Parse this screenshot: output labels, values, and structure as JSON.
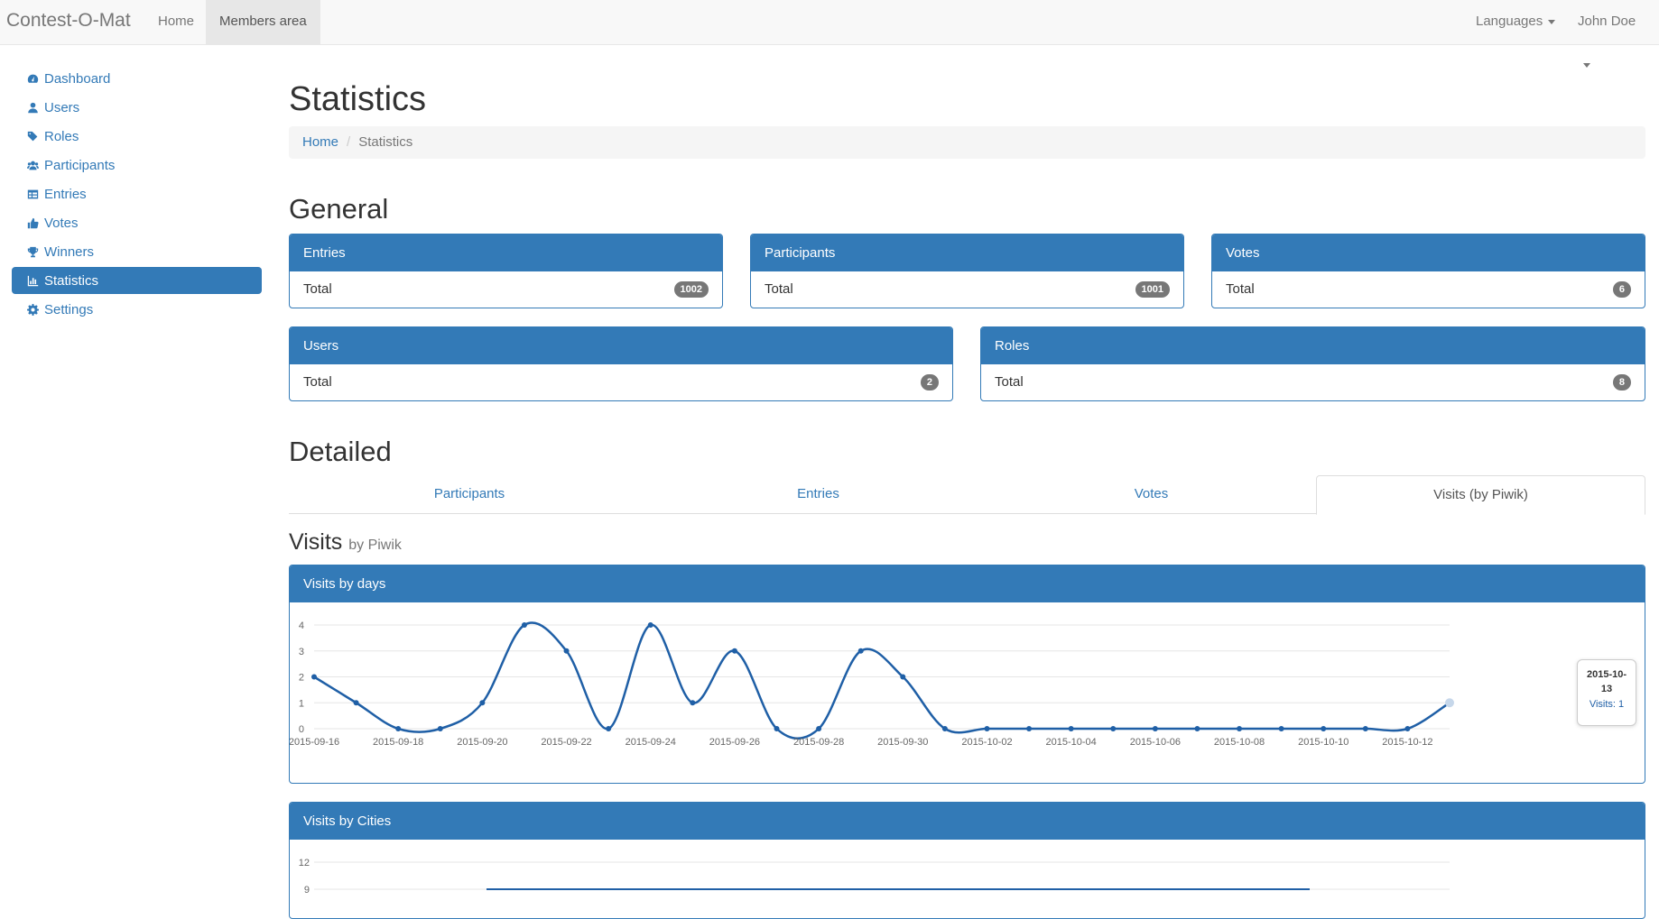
{
  "navbar": {
    "brand": "Contest-O-Mat",
    "home": "Home",
    "members": "Members area",
    "languages": "Languages",
    "user": "John Doe"
  },
  "sidebar": {
    "items": [
      {
        "label": "Dashboard",
        "icon": "dashboard-icon"
      },
      {
        "label": "Users",
        "icon": "user-icon"
      },
      {
        "label": "Roles",
        "icon": "tags-icon"
      },
      {
        "label": "Participants",
        "icon": "users-icon"
      },
      {
        "label": "Entries",
        "icon": "table-icon"
      },
      {
        "label": "Votes",
        "icon": "thumbs-up-icon"
      },
      {
        "label": "Winners",
        "icon": "trophy-icon"
      },
      {
        "label": "Statistics",
        "icon": "bar-chart-icon",
        "active": true
      },
      {
        "label": "Settings",
        "icon": "gear-icon"
      }
    ]
  },
  "page": {
    "title": "Statistics",
    "breadcrumb": {
      "home": "Home",
      "current": "Statistics"
    },
    "general_title": "General",
    "detailed_title": "Detailed"
  },
  "general": {
    "entries": {
      "title": "Entries",
      "row_label": "Total",
      "count": "1002"
    },
    "participants": {
      "title": "Participants",
      "row_label": "Total",
      "count": "1001"
    },
    "votes": {
      "title": "Votes",
      "row_label": "Total",
      "count": "6"
    },
    "users": {
      "title": "Users",
      "row_label": "Total",
      "count": "2"
    },
    "roles": {
      "title": "Roles",
      "row_label": "Total",
      "count": "8"
    }
  },
  "tabs": {
    "participants": "Participants",
    "entries": "Entries",
    "votes": "Votes",
    "visits": "Visits (by Piwik)",
    "active": "visits"
  },
  "visits": {
    "title": "Visits",
    "subtitle": "by Piwik",
    "days_panel_title": "Visits by days",
    "cities_panel_title": "Visits by Cities",
    "tooltip_date": "2015-10-13",
    "tooltip_value": "Visits: 1"
  },
  "colors": {
    "primary": "#337ab7",
    "line": "#1f5fa6",
    "badge": "#777777"
  },
  "chart_data": [
    {
      "type": "line",
      "title": "Visits by days",
      "x": [
        "2015-09-16",
        "2015-09-17",
        "2015-09-18",
        "2015-09-19",
        "2015-09-20",
        "2015-09-21",
        "2015-09-22",
        "2015-09-23",
        "2015-09-24",
        "2015-09-25",
        "2015-09-26",
        "2015-09-27",
        "2015-09-28",
        "2015-09-29",
        "2015-09-30",
        "2015-10-01",
        "2015-10-02",
        "2015-10-03",
        "2015-10-04",
        "2015-10-05",
        "2015-10-06",
        "2015-10-07",
        "2015-10-08",
        "2015-10-09",
        "2015-10-10",
        "2015-10-11",
        "2015-10-12",
        "2015-10-13"
      ],
      "x_tick_labels": [
        "2015-09-16",
        "2015-09-18",
        "2015-09-20",
        "2015-09-22",
        "2015-09-24",
        "2015-09-26",
        "2015-09-28",
        "2015-09-30",
        "2015-10-02",
        "2015-10-04",
        "2015-10-06",
        "2015-10-08",
        "2015-10-10",
        "2015-10-12"
      ],
      "series": [
        {
          "values": [
            2,
            1,
            0,
            0,
            1,
            4,
            3,
            0,
            4,
            1,
            3,
            0,
            0,
            3,
            2,
            0,
            0,
            0,
            0,
            0,
            0,
            0,
            0,
            0,
            0,
            0,
            0,
            1
          ]
        }
      ],
      "yticks": [
        0,
        1,
        2,
        3,
        4
      ],
      "ylim": [
        0,
        4
      ],
      "grid": true
    },
    {
      "type": "bar",
      "title": "Visits by Cities",
      "yticks": [
        "12",
        "9"
      ]
    }
  ]
}
